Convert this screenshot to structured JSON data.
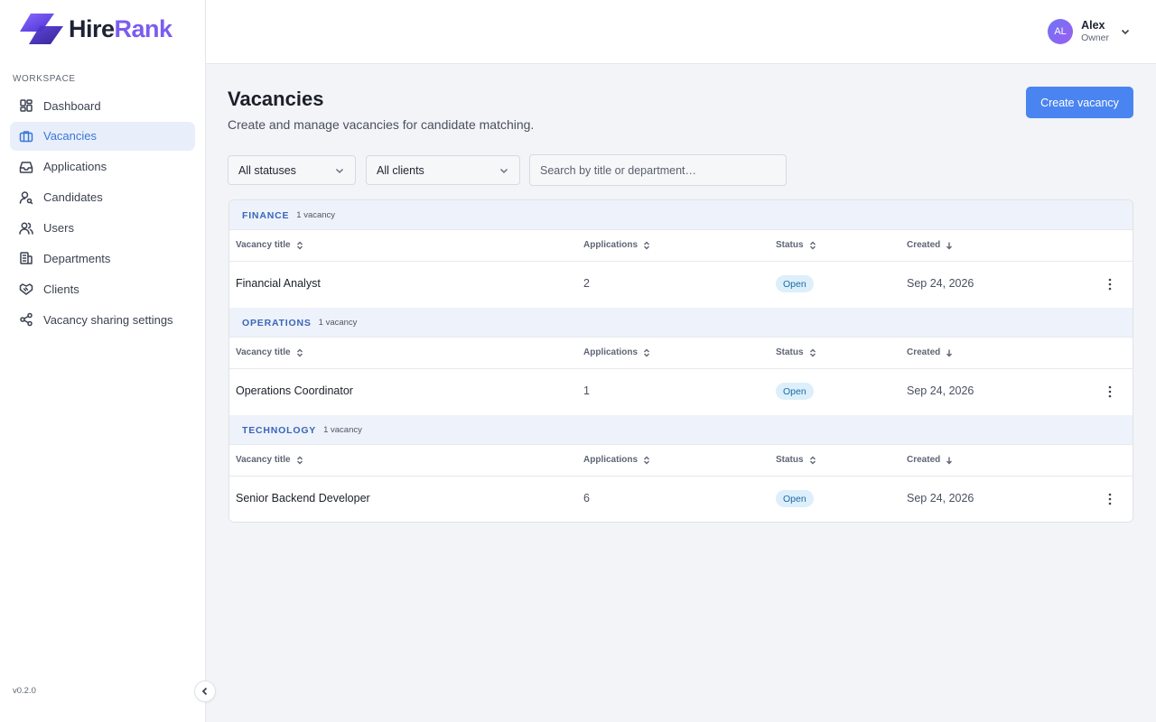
{
  "brand": {
    "name_part1": "Hire",
    "name_part2": "Rank",
    "accent": "#7b5cf0"
  },
  "sidebar": {
    "section_label": "WORKSPACE",
    "items": [
      {
        "label": "Dashboard",
        "icon": "dashboard-icon",
        "active": false
      },
      {
        "label": "Vacancies",
        "icon": "briefcase-icon",
        "active": true
      },
      {
        "label": "Applications",
        "icon": "inbox-icon",
        "active": false
      },
      {
        "label": "Candidates",
        "icon": "user-search-icon",
        "active": false
      },
      {
        "label": "Users",
        "icon": "users-icon",
        "active": false
      },
      {
        "label": "Departments",
        "icon": "building-icon",
        "active": false
      },
      {
        "label": "Clients",
        "icon": "handshake-icon",
        "active": false
      },
      {
        "label": "Vacancy sharing settings",
        "icon": "share-icon",
        "active": false
      }
    ],
    "version": "v0.2.0"
  },
  "user": {
    "initials": "AL",
    "name": "Alex",
    "role": "Owner"
  },
  "page": {
    "title": "Vacancies",
    "subtitle": "Create and manage vacancies for candidate matching.",
    "create_button": "Create vacancy"
  },
  "filters": {
    "status_value": "All statuses",
    "client_value": "All clients",
    "search_placeholder": "Search by title or department…"
  },
  "columns": {
    "title": "Vacancy title",
    "applications": "Applications",
    "status": "Status",
    "created": "Created"
  },
  "groups": [
    {
      "name": "FINANCE",
      "count": "1 vacancy",
      "rows": [
        {
          "title": "Financial Analyst",
          "applications": "2",
          "status": "Open",
          "created": "Sep 24, 2026"
        }
      ]
    },
    {
      "name": "OPERATIONS",
      "count": "1 vacancy",
      "rows": [
        {
          "title": "Operations Coordinator",
          "applications": "1",
          "status": "Open",
          "created": "Sep 24, 2026"
        }
      ]
    },
    {
      "name": "TECHNOLOGY",
      "count": "1 vacancy",
      "rows": [
        {
          "title": "Senior Backend Developer",
          "applications": "6",
          "status": "Open",
          "created": "Sep 24, 2026"
        }
      ]
    }
  ],
  "colors": {
    "primary": "#4a84f0",
    "active_nav_bg": "#e8effb",
    "group_header_bg": "#eef2fb",
    "badge_bg": "#dceffa",
    "badge_text": "#1e6aa8"
  }
}
